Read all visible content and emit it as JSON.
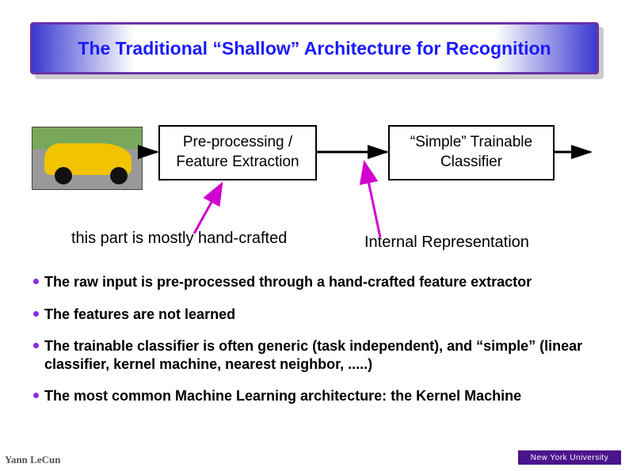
{
  "title": "The Traditional “Shallow” Architecture for Recognition",
  "pipeline": {
    "input_image_alt": "car-photo",
    "preprocess_label": "Pre-processing / Feature Extraction",
    "classifier_label": "“Simple” Trainable Classifier"
  },
  "annotations": {
    "handcrafted": "this part is mostly hand-crafted",
    "internal_rep": "Internal Representation"
  },
  "bullets": [
    "The raw input is pre-processed through a hand-crafted feature extractor",
    "The features are not learned",
    "The trainable classifier is often generic (task independent), and “simple” (linear classifier, kernel machine, nearest neighbor, .....)",
    "The most common Machine Learning architecture: the Kernel Machine"
  ],
  "footer": {
    "author": "Yann LeCun",
    "affiliation": "New York University"
  }
}
